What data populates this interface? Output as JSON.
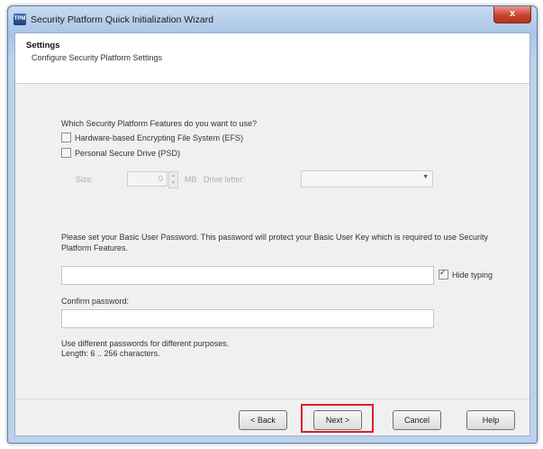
{
  "window": {
    "title": "Security Platform Quick Initialization Wizard",
    "app_icon_text": "TPM",
    "close_symbol": "x"
  },
  "header": {
    "title": "Settings",
    "subtitle": "Configure Security Platform Settings"
  },
  "features": {
    "question": "Which Security Platform Features do you want to use?",
    "efs_label": "Hardware-based Encrypting File System (EFS)",
    "psd_label": "Personal Secure Drive (PSD)",
    "size_label": "Size:",
    "size_value": "0",
    "size_unit": "MB",
    "drive_letter_label": "Drive letter:",
    "drive_letter_value": ""
  },
  "password": {
    "info": "Please set your Basic User Password. This password will protect your Basic User Key which is required to use Security Platform Features.",
    "value": "",
    "hide_typing_label": "Hide typing",
    "hide_typing_checked": true,
    "confirm_label": "Confirm password:",
    "confirm_value": "",
    "hint_line1": "Use different passwords for different purposes.",
    "hint_line2": "Length: 6 .. 256 characters."
  },
  "buttons": {
    "back": "< Back",
    "next": "Next >",
    "cancel": "Cancel",
    "help": "Help"
  },
  "colors": {
    "highlight": "#d6232a",
    "title_bar": "#a9c5e6",
    "close_button": "#c8432d"
  }
}
